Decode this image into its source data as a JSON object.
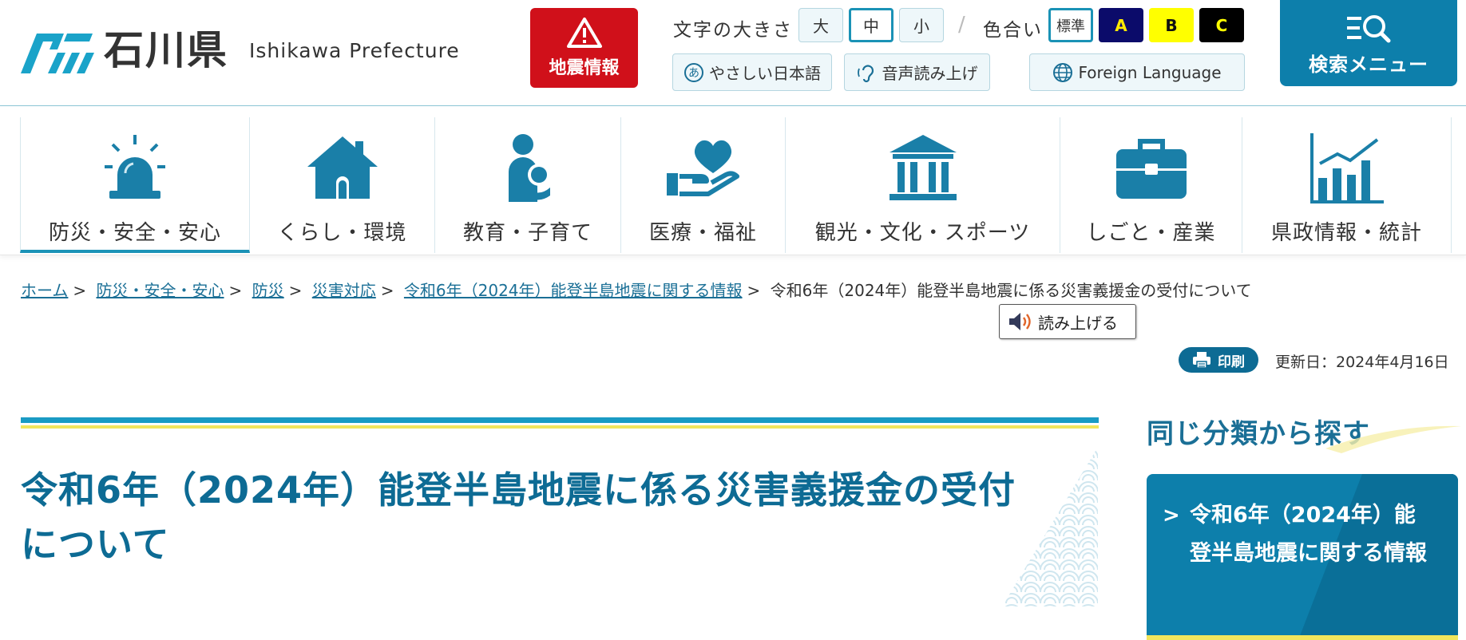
{
  "header": {
    "logo_jp": "石川県",
    "logo_en": "Ishikawa Prefecture",
    "quake_label": "地震情報",
    "font_size_label": "文字の大きさ",
    "font_sizes": [
      "大",
      "中",
      "小"
    ],
    "color_label": "色合い",
    "colors": [
      "標準",
      "A",
      "B",
      "C"
    ],
    "easy_japanese": "やさしい日本語",
    "voice_readout": "音声読み上げ",
    "foreign_language": "Foreign Language",
    "search_menu": "検索メニュー"
  },
  "nav": [
    {
      "label": "防災・安全・安心",
      "icon": "siren-icon"
    },
    {
      "label": "くらし・環境",
      "icon": "house-icon"
    },
    {
      "label": "教育・子育て",
      "icon": "parent-child-icon"
    },
    {
      "label": "医療・福祉",
      "icon": "heart-hand-icon"
    },
    {
      "label": "観光・文化・スポーツ",
      "icon": "museum-icon"
    },
    {
      "label": "しごと・産業",
      "icon": "briefcase-icon"
    },
    {
      "label": "県政情報・統計",
      "icon": "bar-chart-icon"
    }
  ],
  "breadcrumb": {
    "links": [
      "ホーム",
      "防災・安全・安心",
      "防災",
      "災害対応",
      "令和6年（2024年）能登半島地震に関する情報"
    ],
    "current": "令和6年（2024年）能登半島地震に係る災害義援金の受付について"
  },
  "readaloud_label": "読み上げる",
  "print_label": "印刷",
  "updated": "更新日：2024年4月16日",
  "page_title": "令和6年（2024年）能登半島地震に係る災害義援金の受付について",
  "side": {
    "heading": "同じ分類から探す",
    "link": "令和6年（2024年）能登半島地震に関する情報"
  },
  "colors": {
    "primary": "#0d7fab",
    "title": "#0d6b94",
    "quake_red": "#d0101a",
    "accent_yellow": "#f2e55c"
  }
}
